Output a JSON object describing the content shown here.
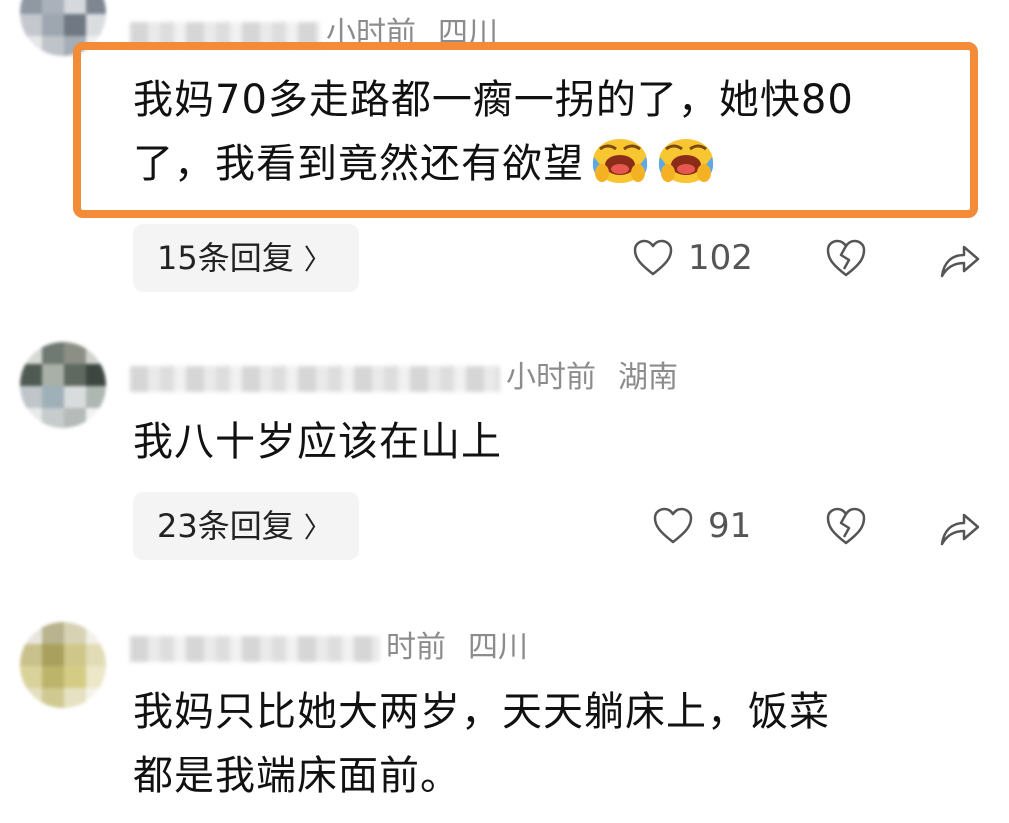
{
  "comments": [
    {
      "time": "小时前",
      "region": "四川",
      "text_lines": [
        "我妈70多走路都一瘸一拐的了，她快80",
        "了，我看到竟然还有欲望"
      ],
      "reply_label": "15条回复",
      "likes": "102",
      "highlighted": true,
      "emojis": [
        "rolling-laugh-emoji",
        "rolling-laugh-emoji"
      ]
    },
    {
      "time": "小时前",
      "region": "湖南",
      "text_lines": [
        "我八十岁应该在山上"
      ],
      "reply_label": "23条回复",
      "likes": "91",
      "highlighted": false
    },
    {
      "time": "时前",
      "region": "四川",
      "text_lines": [
        "我妈只比她大两岁，天天躺床上，饭菜",
        "都是我端床面前。"
      ],
      "highlighted": false
    }
  ],
  "icons": {
    "like": "heart-outline-icon",
    "dislike": "broken-heart-icon",
    "share": "share-arrow-icon",
    "chevron": "chevron-right-icon"
  },
  "colors": {
    "highlight_border": "#f28c38",
    "meta_text": "#8c8c8c",
    "reply_bg": "#f4f4f4"
  }
}
